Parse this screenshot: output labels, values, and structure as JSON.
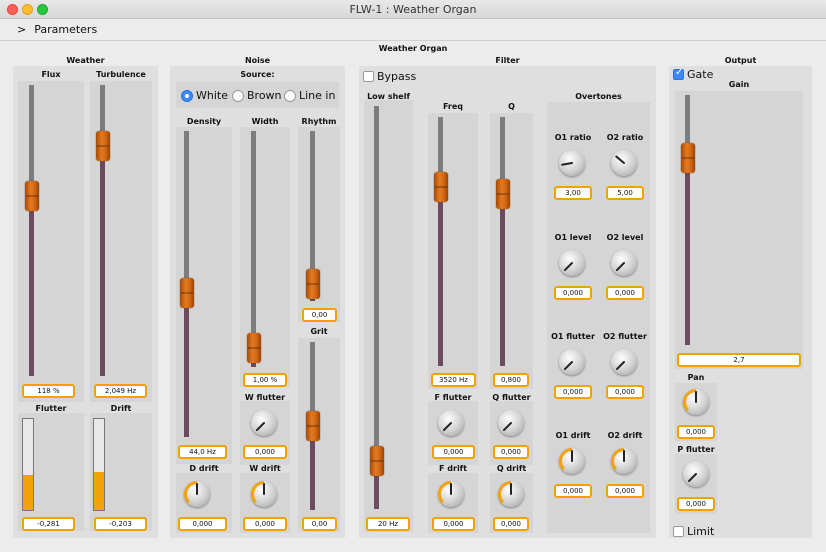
{
  "window": {
    "title": "FLW-1 : Weather Organ"
  },
  "toolbar": {
    "chevron": ">",
    "params_label": "Parameters"
  },
  "main_title": "Weather Organ",
  "colors": {
    "accent": "#f2a100",
    "thumb": "#d06714",
    "fill": "#6d4a5e",
    "meter": "#f4a20a",
    "check": "#3b8af6"
  },
  "weather": {
    "title": "Weather",
    "flux": {
      "label": "Flux",
      "value": "118 %",
      "level": 0.62
    },
    "turbulence": {
      "label": "Turbulence",
      "value": "2,049 Hz",
      "level": 0.79
    },
    "flutter": {
      "label": "Flutter",
      "value": "-0,281",
      "level": 0.38
    },
    "drift": {
      "label": "Drift",
      "value": "-0,203",
      "level": 0.42
    }
  },
  "noise": {
    "title": "Noise",
    "source_label": "Source:",
    "sources": [
      {
        "label": "White",
        "selected": true
      },
      {
        "label": "Brown",
        "selected": false
      },
      {
        "label": "Line in",
        "selected": false
      }
    ],
    "density": {
      "label": "Density",
      "value": "44,0 Hz",
      "level": 0.47
    },
    "width": {
      "label": "Width",
      "value": "1,00 %",
      "level": 0.08
    },
    "rhythm": {
      "label": "Rhythm",
      "value": "0,00",
      "level": 0.1
    },
    "grit": {
      "label": "Grit",
      "value": "0,00",
      "level": 0.5
    },
    "d_drift": {
      "label": "D drift",
      "value": "0,000"
    },
    "w_flutter": {
      "label": "W flutter",
      "value": "0,000"
    },
    "w_drift": {
      "label": "W drift",
      "value": "0,000"
    }
  },
  "filter": {
    "title": "Filter",
    "bypass_label": "Bypass",
    "bypass_checked": false,
    "low_shelf": {
      "label": "Low shelf",
      "value": "20 Hz",
      "level": 0.12
    },
    "freq": {
      "label": "Freq",
      "value": "3520 Hz",
      "level": 0.72
    },
    "q": {
      "label": "Q",
      "value": "0,800",
      "level": 0.69
    },
    "f_flutter": {
      "label": "F flutter",
      "value": "0,000"
    },
    "q_flutter": {
      "label": "Q flutter",
      "value": "0,000"
    },
    "f_drift": {
      "label": "F drift",
      "value": "0,000"
    },
    "q_drift": {
      "label": "Q drift",
      "value": "0,000"
    },
    "overtones": {
      "title": "Overtones",
      "o1_ratio": {
        "label": "O1 ratio",
        "value": "3,00"
      },
      "o2_ratio": {
        "label": "O2 ratio",
        "value": "5,00"
      },
      "o1_level": {
        "label": "O1 level",
        "value": "0,000"
      },
      "o2_level": {
        "label": "O2 level",
        "value": "0,000"
      },
      "o1_flutter": {
        "label": "O1 flutter",
        "value": "0,000"
      },
      "o2_flutter": {
        "label": "O2 flutter",
        "value": "0,000"
      },
      "o1_drift": {
        "label": "O1 drift",
        "value": "0,000"
      },
      "o2_drift": {
        "label": "O2 drift",
        "value": "0,000"
      }
    }
  },
  "output": {
    "title": "Output",
    "gate_label": "Gate",
    "gate_checked": true,
    "gain": {
      "label": "Gain",
      "value": "2,7",
      "level": 0.75
    },
    "pan": {
      "label": "Pan",
      "value": "0,000"
    },
    "p_flutter": {
      "label": "P flutter",
      "value": "0,000"
    },
    "limit_label": "Limit",
    "limit_checked": false
  }
}
